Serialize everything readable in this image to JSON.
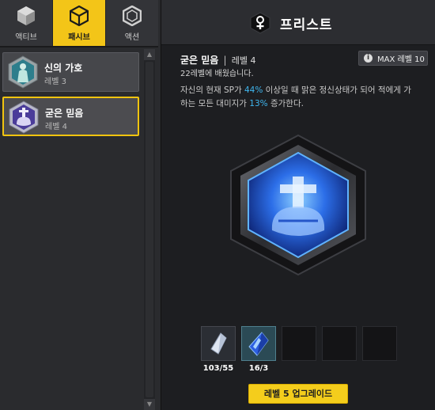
{
  "tabs": [
    {
      "label": "액티브",
      "icon": "cube-icon"
    },
    {
      "label": "패시브",
      "icon": "cube-outline-icon"
    },
    {
      "label": "액션",
      "icon": "hexagon-icon"
    }
  ],
  "skills": [
    {
      "name": "신의 가호",
      "level": "레벨 3",
      "icon": "goddess-icon"
    },
    {
      "name": "굳은 믿음",
      "level": "레벨 4",
      "icon": "faith-fist-icon"
    }
  ],
  "header": {
    "class_name": "프리스트",
    "icon": "priest-class-icon"
  },
  "detail": {
    "skill_name": "굳은 믿음",
    "separator": "|",
    "level": "레벨 4",
    "learned": "22레벨에 배웠습니다.",
    "max_level": "MAX 레벨 10",
    "desc_1": "자신의 현재 SP가 ",
    "desc_hl1": "44%",
    "desc_2": " 이상일 때 맑은 정신상태가 되어 적에게 가하는 모든 대미지가 ",
    "desc_hl2": "13%",
    "desc_3": " 증가한다."
  },
  "materials": [
    {
      "count": "103/55",
      "icon": "white-crystal-icon"
    },
    {
      "count": "16/3",
      "icon": "blue-crystal-icon"
    }
  ],
  "upgrade_button": "레벨 5 업그레이드",
  "colors": {
    "accent": "#f4cd1c",
    "highlight": "#3fb7f0"
  }
}
